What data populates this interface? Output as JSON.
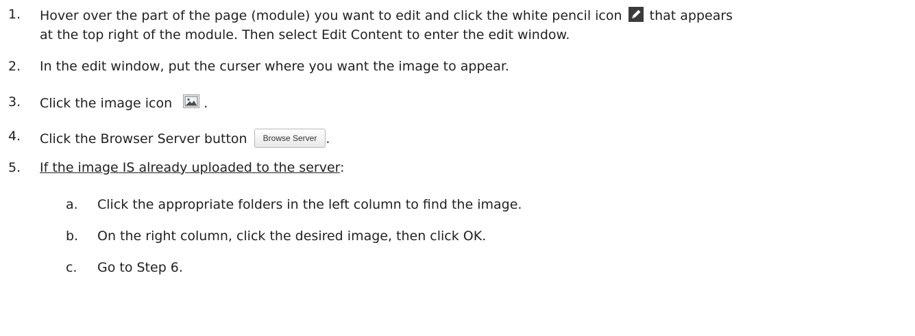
{
  "steps": [
    {
      "number": "1.",
      "line1_before_icon": "Hover over the part of the page (module) you want to edit and click the white pencil icon",
      "line1_after_icon": "that appears",
      "line2": "at the top right of the module. Then select Edit Content to enter the edit window."
    },
    {
      "number": "2.",
      "text": "In the edit window, put the curser where you want the image to appear."
    },
    {
      "number": "3.",
      "text": "Click the image icon",
      "after_icon": "."
    },
    {
      "number": "4.",
      "text": "Click the Browser Server button",
      "button_label": "Browse Server",
      "after_button": "."
    },
    {
      "number": "5.",
      "underlined": "If the image IS already uploaded to the server",
      "after": ":"
    }
  ],
  "substeps": [
    {
      "letter": "a.",
      "text": "Click the appropriate folders in the left column to find the image."
    },
    {
      "letter": "b.",
      "text": "On the right column, click the desired image, then click OK."
    },
    {
      "letter": "c.",
      "text": "Go to Step 6."
    }
  ],
  "icons": {
    "pencil": "pencil-icon",
    "image": "image-icon"
  }
}
